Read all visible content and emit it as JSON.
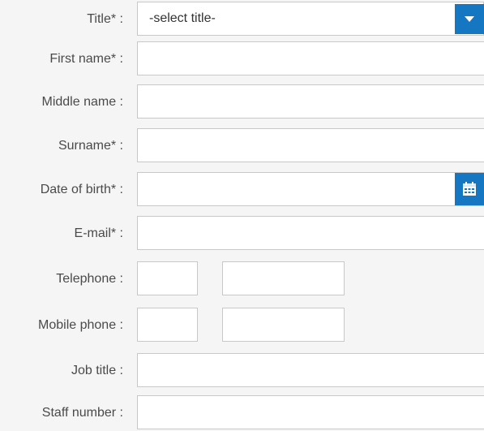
{
  "form": {
    "title_label": "Title* :",
    "title_select_value": "-select title-",
    "first_name_label": "First name* :",
    "middle_name_label": "Middle name :",
    "surname_label": "Surname* :",
    "dob_label": "Date of birth* :",
    "email_label": "E-mail* :",
    "telephone_label": "Telephone :",
    "mobile_label": "Mobile phone :",
    "job_title_label": "Job title :",
    "staff_number_label": "Staff number :"
  },
  "icons": {
    "dropdown": "chevron-down-icon",
    "calendar": "calendar-icon"
  },
  "colors": {
    "accent": "#1577c2",
    "background": "#f5f5f5",
    "field_border": "#c8c8c8",
    "label_text": "#4a4a4a"
  }
}
